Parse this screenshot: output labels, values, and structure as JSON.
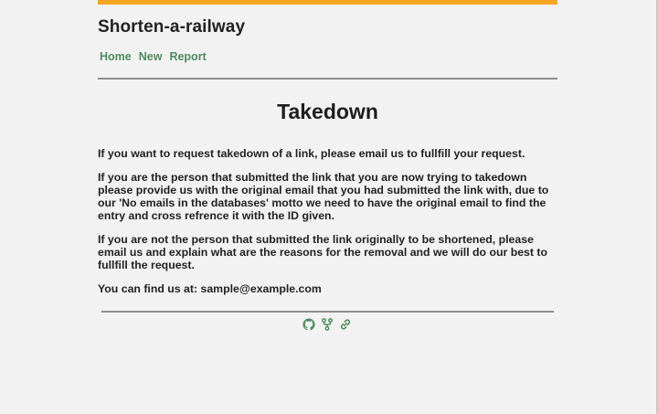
{
  "site": {
    "title": "Shorten-a-railway",
    "accent_color": "#f6a623",
    "link_color": "#4f8a5e"
  },
  "nav": {
    "items": [
      {
        "label": "Home"
      },
      {
        "label": "New"
      },
      {
        "label": "Report"
      }
    ]
  },
  "page": {
    "heading": "Takedown",
    "paragraphs": [
      "If you want to request takedown of a link, please email us to fullfill your request.",
      "If you are the person that submitted the link that you are now trying to takedown please provide us with the original email that you had submitted the link with, due to our 'No emails in the databases' motto we need to have the original email to find the entry and cross refrence it with the ID given.",
      "If you are not the person that submitted the link originally to be shortened, please email us and explain what are the reasons for the removal and we will do our best to fullfill the request.",
      "You can find us at: sample@example.com"
    ]
  },
  "footer": {
    "icons": [
      "github-icon",
      "fork-icon",
      "link-icon"
    ]
  }
}
